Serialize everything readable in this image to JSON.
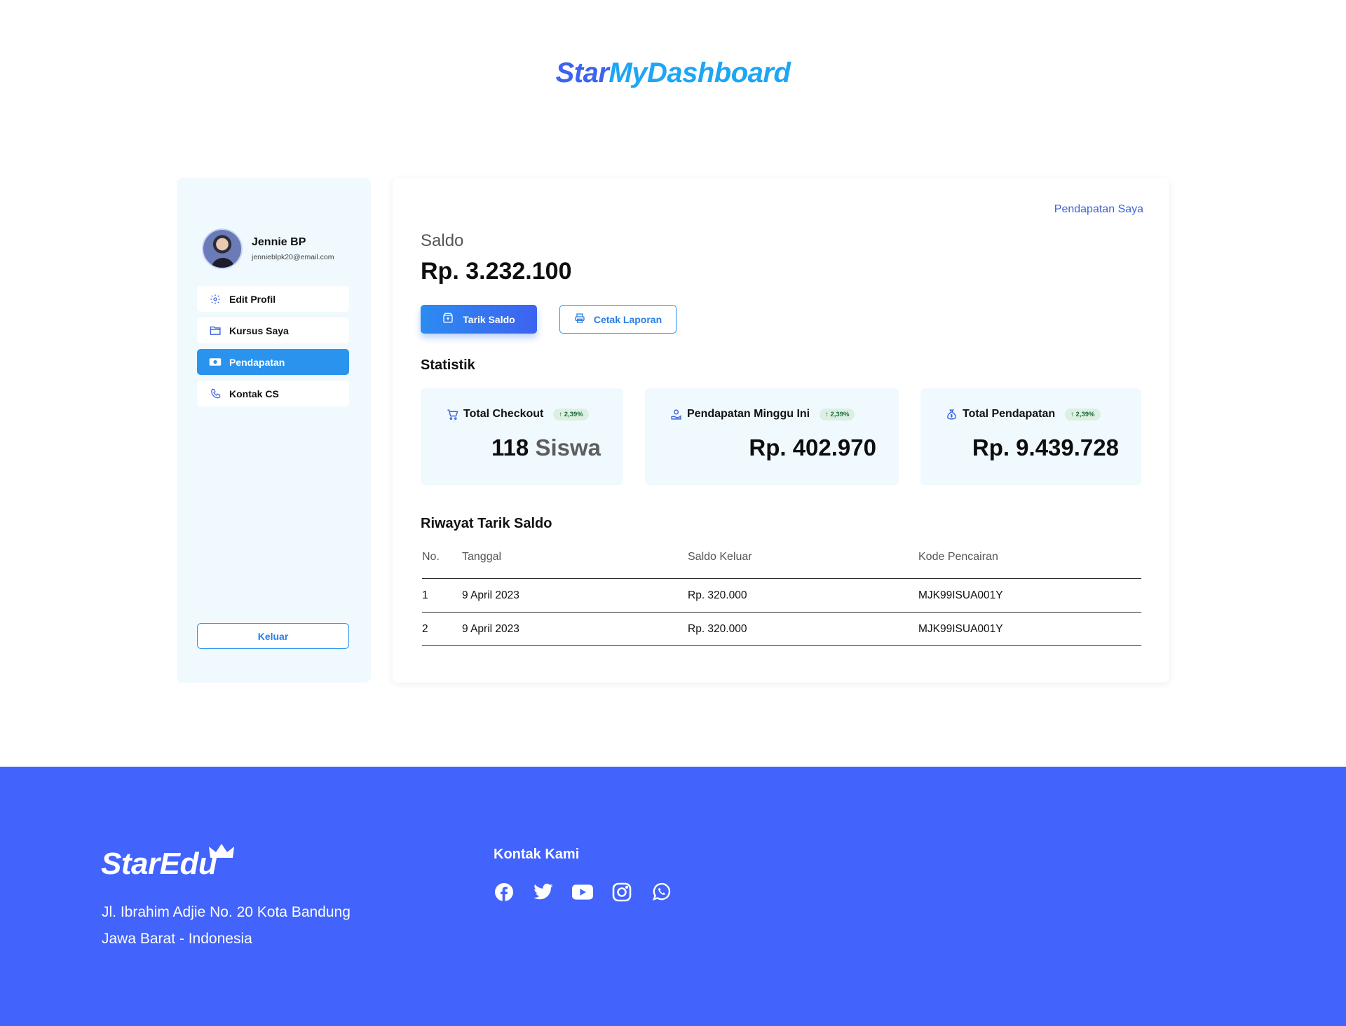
{
  "brand": {
    "part1": "Star",
    "part2": "MyDashboard"
  },
  "profile": {
    "name": "Jennie BP",
    "email": "jennieblpk20@email.com"
  },
  "sidebar": {
    "items": [
      {
        "label": "Edit Profil",
        "icon": "gear-icon"
      },
      {
        "label": "Kursus Saya",
        "icon": "folder-icon"
      },
      {
        "label": "Pendapatan",
        "icon": "money-icon",
        "active": true
      },
      {
        "label": "Kontak CS",
        "icon": "phone-icon"
      }
    ],
    "logout_label": "Keluar"
  },
  "main": {
    "page_link": "Pendapatan Saya",
    "saldo_label": "Saldo",
    "saldo_value": "Rp. 3.232.100",
    "btn_withdraw": "Tarik Saldo",
    "btn_print": "Cetak Laporan",
    "stats_title": "Statistik",
    "stats": [
      {
        "label": "Total Checkout",
        "badge": "↑ 2,39%",
        "value": "118",
        "unit": "Siswa",
        "icon": "cart-icon"
      },
      {
        "label": "Pendapatan Minggu Ini",
        "badge": "↑ 2,39%",
        "value": "Rp. 402.970",
        "icon": "hand-coin-icon"
      },
      {
        "label": "Total Pendapatan",
        "badge": "↑ 2,39%",
        "value": "Rp. 9.439.728",
        "icon": "money-bag-icon"
      }
    ],
    "history_title": "Riwayat Tarik Saldo",
    "table": {
      "headers": [
        "No.",
        "Tanggal",
        "Saldo Keluar",
        "Kode Pencairan"
      ],
      "rows": [
        [
          "1",
          "9 April 2023",
          "Rp. 320.000",
          "MJK99ISUA001Y"
        ],
        [
          "2",
          "9 April 2023",
          "Rp. 320.000",
          "MJK99ISUA001Y"
        ]
      ]
    }
  },
  "footer": {
    "logo": "StarEdu",
    "address_line1": "Jl. Ibrahim Adjie No. 20 Kota Bandung",
    "address_line2": "Jawa Barat - Indonesia",
    "contact_title": "Kontak Kami",
    "socials": [
      "facebook-icon",
      "twitter-icon",
      "youtube-icon",
      "instagram-icon",
      "whatsapp-icon"
    ]
  },
  "colors": {
    "accent": "#2a93ee",
    "brand_blue": "#3e63f0",
    "footer_bg": "#4263fc",
    "panel_bg": "#f0f9fd"
  }
}
